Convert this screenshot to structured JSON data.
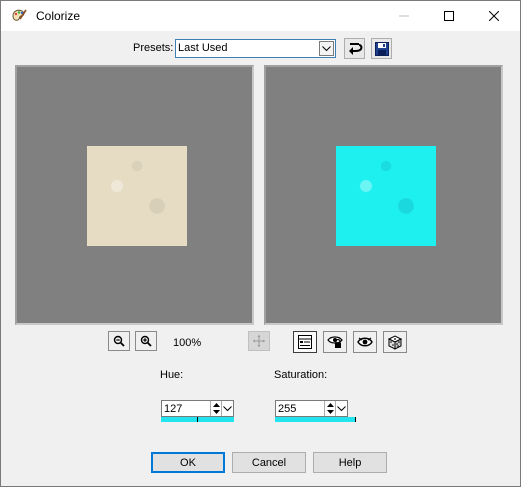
{
  "window": {
    "title": "Colorize",
    "icon": "palette-brush-icon",
    "controls": [
      "minimize-icon",
      "maximize-icon",
      "close-icon"
    ]
  },
  "presets": {
    "label": "Presets:",
    "value": "Last Used",
    "reset_icon": "reset-arrow-icon",
    "save_icon": "floppy-disk-icon"
  },
  "preview": {
    "before_color": "#e6dcc4",
    "after_color": "#1ef0f0",
    "background": "#808080"
  },
  "toolbar": {
    "zoom_out_icon": "zoom-out-icon",
    "zoom_in_icon": "zoom-in-icon",
    "zoom_level": "100%",
    "pan_icon": "pan-move-icon",
    "preview_toggle_icon": "preview-on-image-icon",
    "proof_icon": "proof-icon",
    "auto_proof_icon": "auto-proof-eye-icon",
    "randomize_icon": "randomize-dice-icon"
  },
  "hue": {
    "label": "Hue:",
    "value": "127",
    "fraction": 0.5
  },
  "saturation": {
    "label": "Saturation:",
    "value": "255",
    "fraction": 1.0
  },
  "buttons": {
    "ok": "OK",
    "cancel": "Cancel",
    "help": "Help"
  },
  "colors": {
    "accent": "#0078d7",
    "level_bar": "#22e4ee"
  }
}
